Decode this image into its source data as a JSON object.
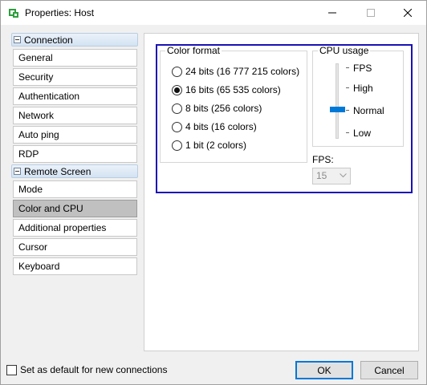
{
  "window": {
    "title": "Properties: Host",
    "accent_color": "#0078d7",
    "highlight_color": "#1a12b4"
  },
  "nav": {
    "group_connection": "Connection",
    "connection_items": [
      "General",
      "Security",
      "Authentication",
      "Network",
      "Auto ping",
      "RDP"
    ],
    "group_remote_screen": "Remote Screen",
    "remote_items": [
      "Mode",
      "Color and CPU",
      "Additional properties",
      "Cursor",
      "Keyboard"
    ],
    "selected": "Color and CPU"
  },
  "color_format": {
    "legend": "Color format",
    "options": [
      {
        "label": "24 bits (16 777 215 colors)",
        "checked": false
      },
      {
        "label": "16 bits (65 535 colors)",
        "checked": true
      },
      {
        "label": "8 bits (256 colors)",
        "checked": false
      },
      {
        "label": "4 bits (16 colors)",
        "checked": false
      },
      {
        "label": "1 bit (2 colors)",
        "checked": false
      }
    ]
  },
  "cpu_usage": {
    "legend": "CPU usage",
    "levels": [
      "FPS",
      "High",
      "Normal",
      "Low"
    ],
    "selected_level": "Normal"
  },
  "fps": {
    "label": "FPS:",
    "value": "15"
  },
  "footer": {
    "default_checkbox_label": "Set as default for new connections",
    "default_checked": false,
    "ok_label": "OK",
    "cancel_label": "Cancel"
  }
}
